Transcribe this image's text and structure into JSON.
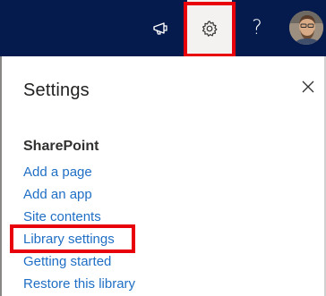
{
  "suite_bar": {
    "icons": [
      "megaphone-icon",
      "gear-icon",
      "help-icon",
      "avatar"
    ],
    "help_label": "?"
  },
  "settings_panel": {
    "title": "Settings",
    "section_heading": "SharePoint",
    "links": [
      "Add a page",
      "Add an app",
      "Site contents",
      "Library settings",
      "Getting started",
      "Restore this library"
    ]
  },
  "colors": {
    "suite_bar": "#051a4d",
    "link": "#1f6fc5",
    "highlight": "#e8000b",
    "active_icon_bg": "#f3f2f1"
  }
}
